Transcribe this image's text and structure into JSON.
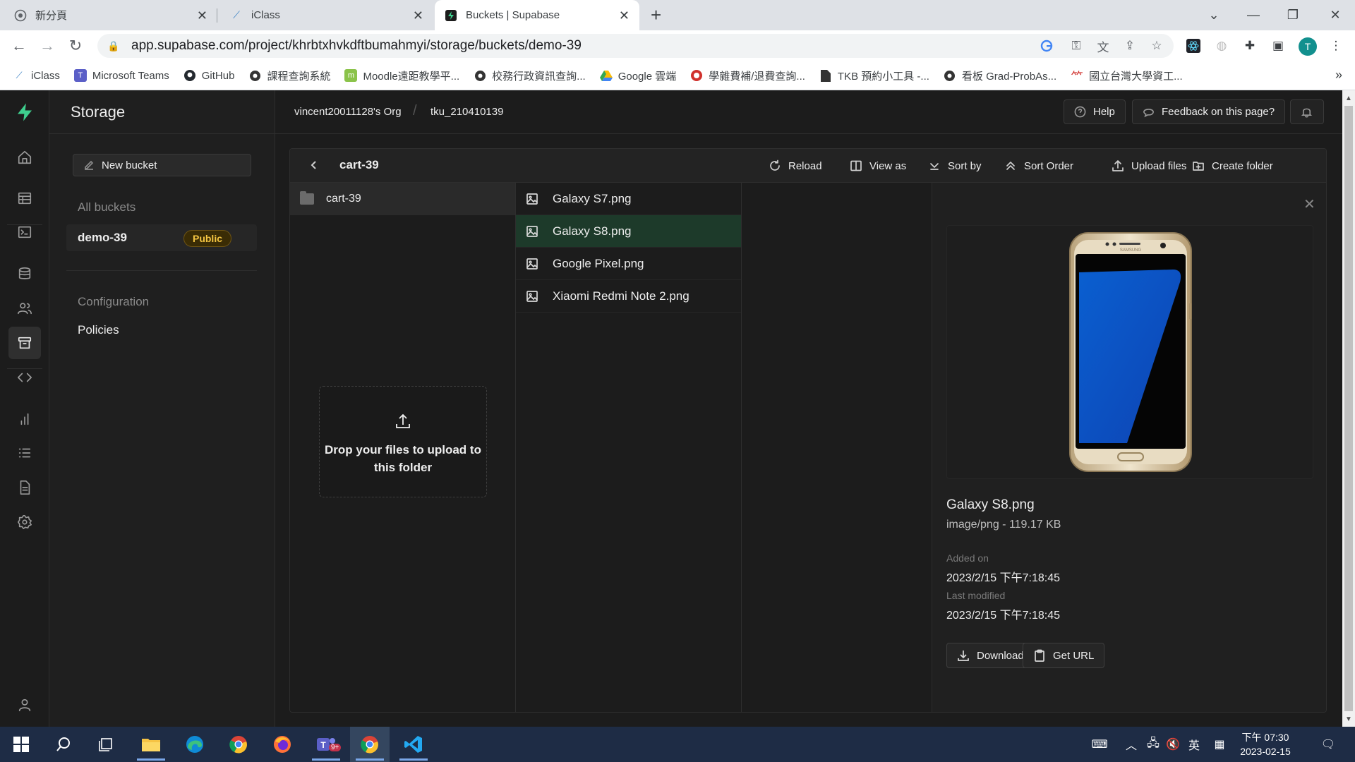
{
  "browser": {
    "tabs": [
      {
        "title": "新分頁",
        "icon": "chrome-newtab-icon"
      },
      {
        "title": "iClass",
        "icon": "iclass-icon"
      },
      {
        "title": "Buckets | Supabase",
        "icon": "supabase-icon",
        "active": true
      }
    ],
    "url": "app.supabase.com/project/khrbtxhvkdftbumahmyi/storage/buckets/demo-39",
    "profile_initial": "T",
    "bookmarks": [
      {
        "label": "iClass",
        "icon": "iclass-icon"
      },
      {
        "label": "Microsoft Teams",
        "icon": "teams-icon"
      },
      {
        "label": "GitHub",
        "icon": "github-icon"
      },
      {
        "label": "課程查詢系統",
        "icon": "globe-icon"
      },
      {
        "label": "Moodle遠距教學平...",
        "icon": "moodle-icon"
      },
      {
        "label": "校務行政資訊查詢...",
        "icon": "globe-icon"
      },
      {
        "label": "Google 雲端",
        "icon": "drive-icon"
      },
      {
        "label": "學雜費補/退費查詢...",
        "icon": "seal-icon"
      },
      {
        "label": "TKB 預約小工具 -...",
        "icon": "doc-icon"
      },
      {
        "label": "看板 Grad-ProbAs...",
        "icon": "globe-icon"
      },
      {
        "label": "國立台灣大學資工...",
        "icon": "ntu-icon"
      }
    ]
  },
  "app": {
    "section_title": "Storage",
    "breadcrumb": {
      "org": "vincent20011128's Org",
      "project": "tku_210410139"
    },
    "top_buttons": {
      "help": "Help",
      "feedback": "Feedback on this page?"
    },
    "sidebar": {
      "new_bucket": "New bucket",
      "all_buckets_label": "All buckets",
      "bucket_name": "demo-39",
      "bucket_badge": "Public",
      "configuration_label": "Configuration",
      "policies": "Policies"
    },
    "explorer": {
      "current_folder": "cart-39",
      "toolbar": {
        "reload": "Reload",
        "view_as": "View as",
        "sort_by": "Sort by",
        "sort_order": "Sort Order",
        "upload": "Upload files",
        "create_folder": "Create folder"
      },
      "column1_folder": "cart-39",
      "dropzone_text": "Drop your files to upload to this folder",
      "files": [
        "Galaxy S7.png",
        "Galaxy S8.png",
        "Google Pixel.png",
        "Xiaomi Redmi Note 2.png"
      ],
      "selected_index": 1
    },
    "preview": {
      "file_name": "Galaxy S8.png",
      "meta": "image/png - 119.17 KB",
      "added_label": "Added on",
      "added_value": "2023/2/15 下午7:18:45",
      "modified_label": "Last modified",
      "modified_value": "2023/2/15 下午7:18:45",
      "download": "Download",
      "get_url": "Get URL",
      "phone_brand": "SAMSUNG"
    }
  },
  "taskbar": {
    "clock_time": "下午 07:30",
    "clock_date": "2023-02-15",
    "ime": "英",
    "teams_badge": "9+"
  },
  "colors": {
    "brand": "#3ecf8e",
    "selected_row": "#1d3a2a",
    "badge_text": "#f4c542"
  }
}
